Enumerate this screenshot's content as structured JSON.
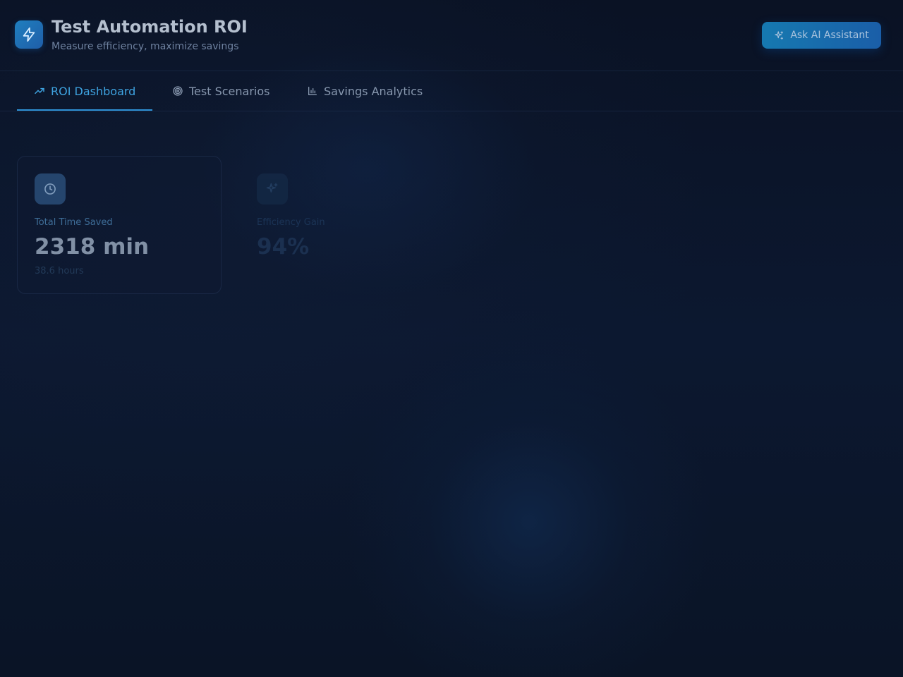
{
  "header": {
    "logo_icon": "lightning-bolt-icon",
    "title": "Test Automation ROI",
    "subtitle": "Measure efficiency, maximize savings",
    "ai_button": {
      "label": "Ask AI Assistant",
      "icon": "sparkles-icon"
    }
  },
  "tabs": [
    {
      "label": "ROI Dashboard",
      "icon": "trending-up-icon",
      "active": true
    },
    {
      "label": "Test Scenarios",
      "icon": "target-icon",
      "active": false
    },
    {
      "label": "Savings Analytics",
      "icon": "bar-chart-icon",
      "active": false
    }
  ],
  "cards": [
    {
      "icon": "clock-icon",
      "label": "Total Time Saved",
      "value": "2318 min",
      "sub": "38.6 hours"
    },
    {
      "icon": "sparkles-icon",
      "label": "Efficiency Gain",
      "value": "94%",
      "sub": ""
    }
  ],
  "colors": {
    "background": "#0b1426",
    "accent": "#2f92d6",
    "button": "#1679b0"
  }
}
